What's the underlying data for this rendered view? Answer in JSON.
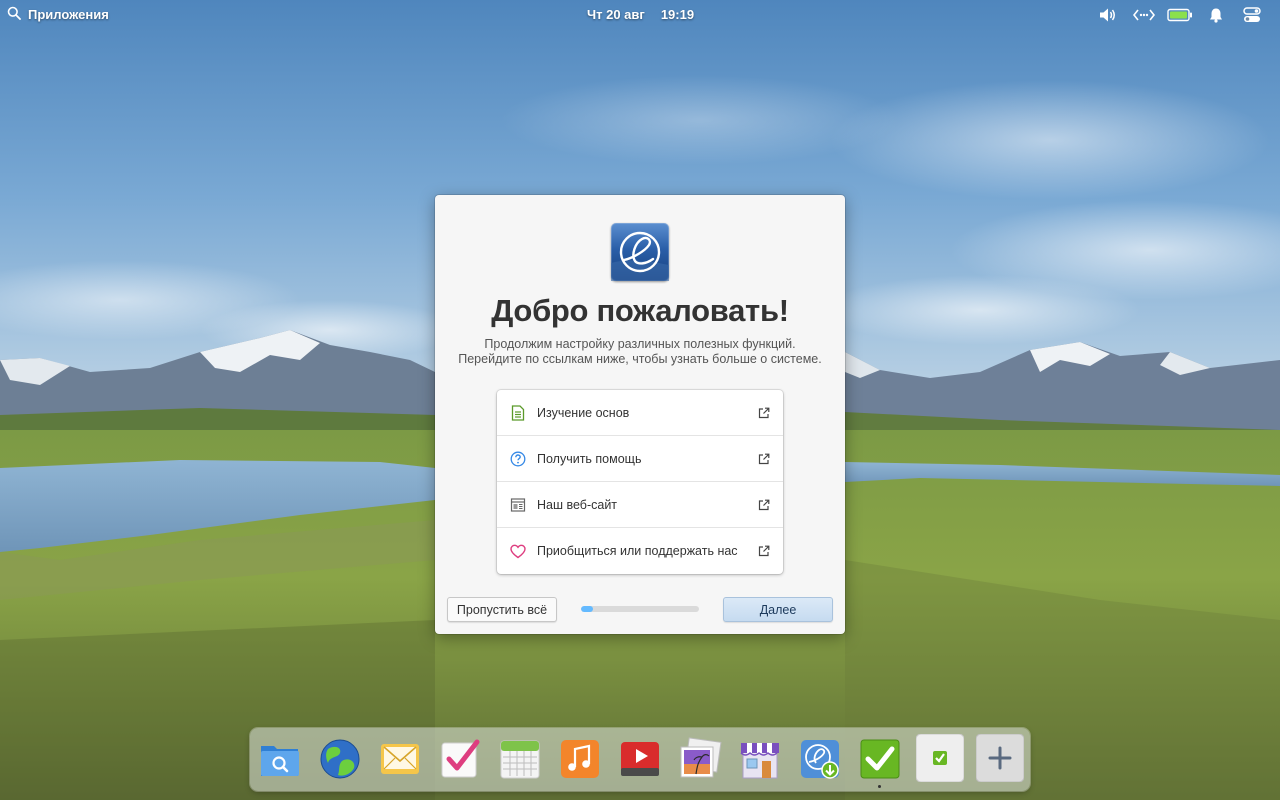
{
  "panel": {
    "applications_label": "Приложения",
    "date": "Чт 20 авг",
    "time": "19:19",
    "indicators": [
      "volume-icon",
      "network-icon",
      "battery-icon",
      "notifications-icon",
      "session-icon"
    ],
    "battery_color": "#8be04d"
  },
  "dialog": {
    "title": "Добро пожаловать!",
    "subtitle_line1": "Продолжим настройку различных полезных функций.",
    "subtitle_line2": "Перейдите по ссылкам ниже, чтобы узнать больше о системе.",
    "links": [
      {
        "label": "Изучение основ",
        "icon": "document-icon",
        "color": "#5b9a2a"
      },
      {
        "label": "Получить помощь",
        "icon": "help-icon",
        "color": "#3689e6"
      },
      {
        "label": "Наш веб-сайт",
        "icon": "website-icon",
        "color": "#666666"
      },
      {
        "label": "Приобщиться или поддержать нас",
        "icon": "heart-icon",
        "color": "#de3e80"
      }
    ],
    "skip_label": "Пропустить всё",
    "next_label": "Далее",
    "progress_fraction": 0.1,
    "accent_color": "#64baff"
  },
  "dock": {
    "items": [
      "files-icon",
      "web-browser-icon",
      "mail-icon",
      "tasks-icon",
      "calendar-icon",
      "music-icon",
      "videos-icon",
      "photos-icon",
      "appcenter-icon",
      "installer-icon",
      "checkmark-app-icon",
      "small-check-app-icon",
      "add-icon"
    ]
  }
}
